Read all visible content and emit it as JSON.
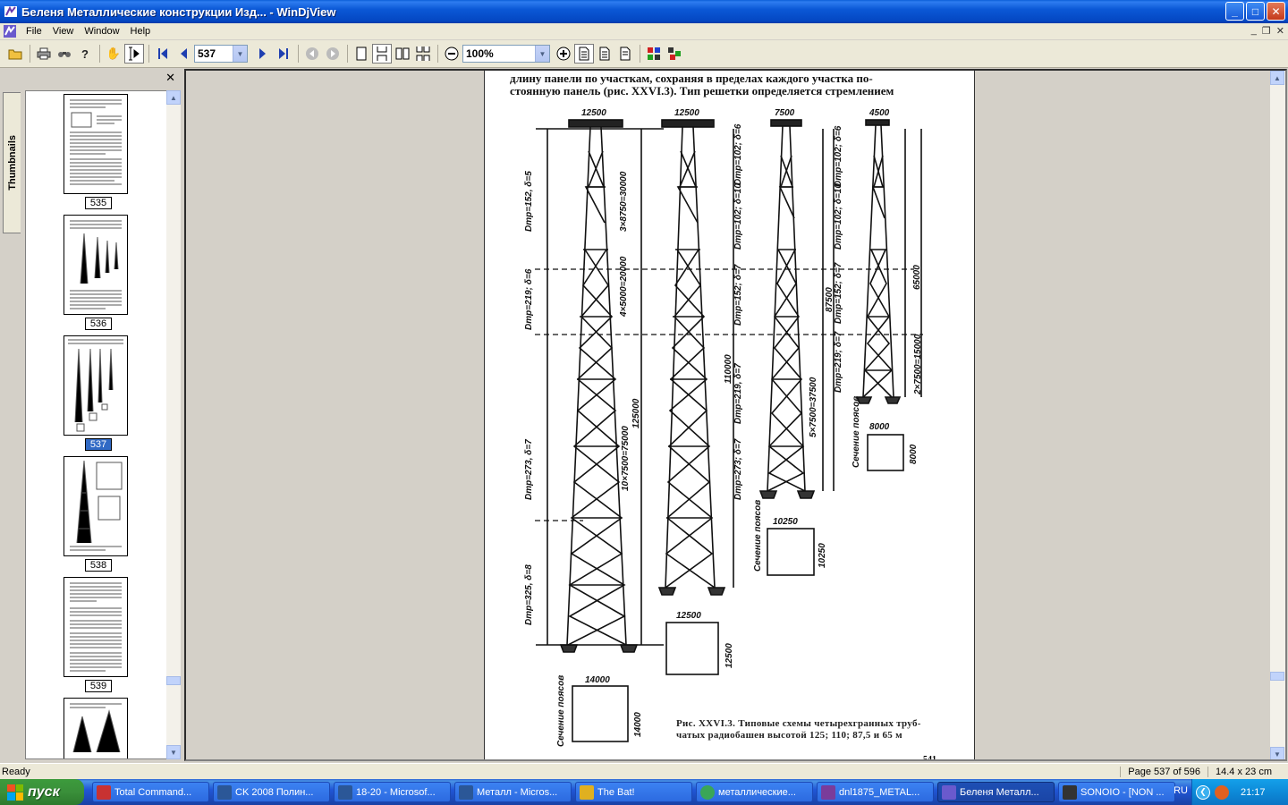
{
  "window": {
    "title": "Беленя Металлические конструкции Изд... - WinDjView",
    "minimize": "_",
    "maximize": "□",
    "close": "✕"
  },
  "menu": {
    "items": [
      "File",
      "View",
      "Window",
      "Help"
    ],
    "mdi_min": "_",
    "mdi_restore": "❐",
    "mdi_close": "✕"
  },
  "toolbar": {
    "page_value": "537",
    "zoom_value": "100%",
    "icons": [
      "open-icon",
      "print-icon",
      "find-icon",
      "help-icon",
      "hand-icon",
      "select-icon",
      "first-page-icon",
      "prev-page-icon",
      "next-page-icon",
      "last-page-icon",
      "back-icon",
      "forward-icon",
      "single-page-icon",
      "fit-height-icon",
      "two-pages-icon",
      "continuous-icon",
      "zoom-out-icon",
      "zoom-in-icon",
      "fit-page-icon",
      "fit-width-icon",
      "actual-size-icon",
      "color-icon",
      "layout-icon"
    ]
  },
  "sidebar": {
    "tab_label": "Thumbnails",
    "close": "✕",
    "thumbnails": [
      {
        "label": "535",
        "selected": false
      },
      {
        "label": "536",
        "selected": false
      },
      {
        "label": "537",
        "selected": true
      },
      {
        "label": "538",
        "selected": false
      },
      {
        "label": "539",
        "selected": false
      }
    ]
  },
  "document": {
    "text_line1": "длину панели по участкам, сохраняя в пределах каждого участка по-",
    "text_line2": "стоянную панель (рис. XXVI.3). Тип решетки определяется стремлением",
    "top_widths": [
      "12500",
      "12500",
      "7500",
      "4500"
    ],
    "section_labels": [
      "14000",
      "14000",
      "12500",
      "12500",
      "10250",
      "10250",
      "8000",
      "8000"
    ],
    "section_captions": [
      "Сечение поясов",
      "Сечение поясов",
      "Сечение поясов"
    ],
    "height_labels": [
      "125000",
      "110000",
      "87500",
      "65000"
    ],
    "segment_labels": [
      "3×8750=30000",
      "4×5000=20000",
      "10×7500=75000",
      "5×7500=37500",
      "2×7500=15000"
    ],
    "pipe_labels": [
      "Dтр=152, δ=5",
      "Dтр=219; δ=6",
      "Dтр=273, δ=7",
      "Dтр=325, δ=8",
      "Dтр=102; δ=6",
      "Dтр=102; δ=10",
      "Dтр=152; δ=7",
      "Dтр=219, δ=7",
      "Dтр=273; δ=7",
      "Dтр=102; δ=6",
      "Dтр=102; δ=10",
      "Dтр=152; δ=7",
      "Dтр=219; δ=7"
    ],
    "caption_line1": "Рис. XXVI.3. Типовые схемы четырехгранных труб-",
    "caption_line2": "чатых радиобашен высотой 125; 110; 87,5 и 65 м",
    "page_number": "541"
  },
  "status": {
    "left": "Ready",
    "page": "Page 537 of 596",
    "size": "14.4 x 23 cm"
  },
  "taskbar": {
    "start": "пуск",
    "tasks": [
      {
        "label": "Total Command...",
        "color": "#c83232",
        "active": false
      },
      {
        "label": "CK 2008 Полин...",
        "color": "#2b5797",
        "active": false
      },
      {
        "label": "18-20 - Microsof...",
        "color": "#2b5797",
        "active": false
      },
      {
        "label": "Металл - Micros...",
        "color": "#2b5797",
        "active": false
      },
      {
        "label": "The Bat!",
        "color": "#e0b020",
        "active": false
      },
      {
        "label": "металлические...",
        "color": "#3aa657",
        "active": false
      },
      {
        "label": "dnl1875_METAL...",
        "color": "#7a3c9a",
        "active": false
      },
      {
        "label": "Беленя Металл...",
        "color": "#6a5acd",
        "active": true
      },
      {
        "label": "SONOIO - [NON ...",
        "color": "#333333",
        "active": false
      }
    ],
    "lang": "RU",
    "clock": "21:17"
  }
}
